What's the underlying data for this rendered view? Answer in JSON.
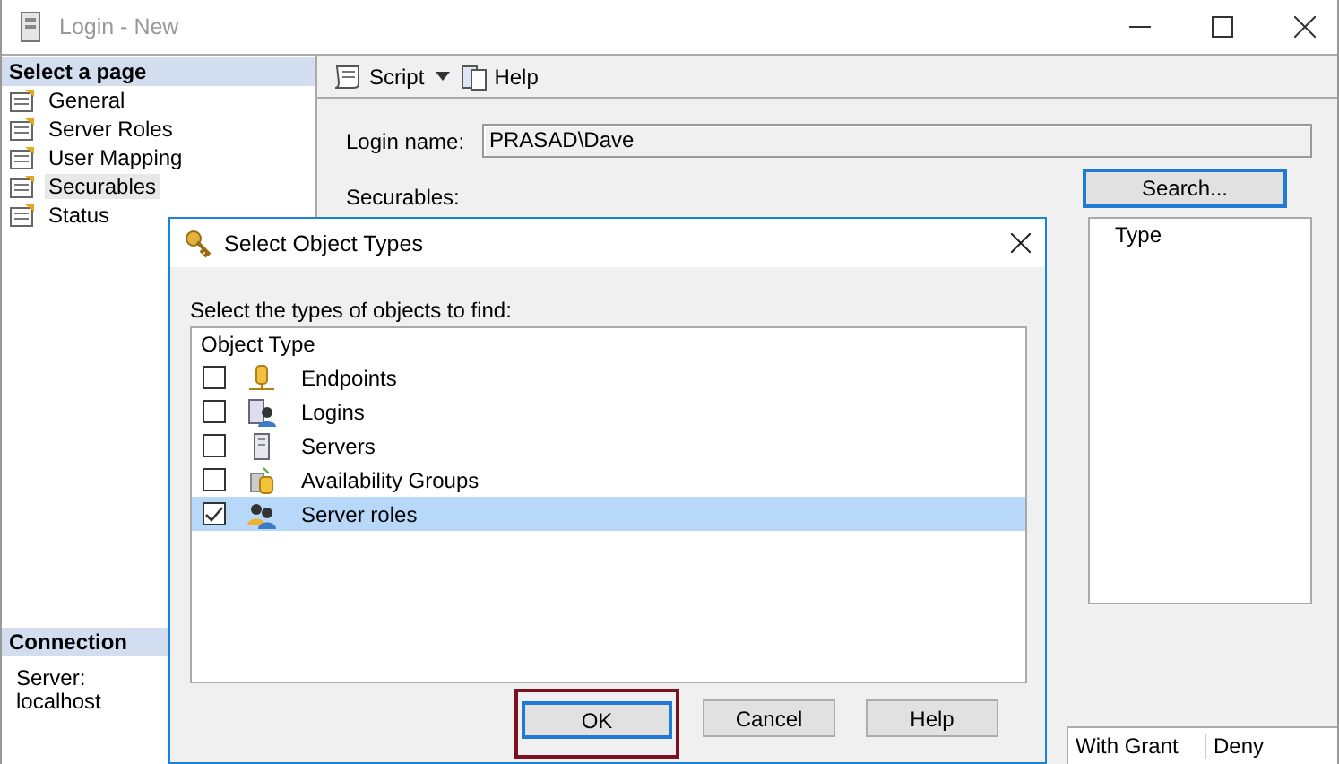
{
  "window": {
    "title": "Login - New"
  },
  "sidebar": {
    "header": "Select a page",
    "items": [
      {
        "label": "General",
        "selected": false
      },
      {
        "label": "Server Roles",
        "selected": false
      },
      {
        "label": "User Mapping",
        "selected": false
      },
      {
        "label": "Securables",
        "selected": true
      },
      {
        "label": "Status",
        "selected": false
      }
    ],
    "connection": {
      "header": "Connection",
      "label": "Server:",
      "value": "localhost"
    }
  },
  "toolbar": {
    "script": "Script",
    "help": "Help"
  },
  "form": {
    "login_label": "Login name:",
    "login_value": "PRASAD\\Dave",
    "securables_label": "Securables:",
    "search_button": "Search...",
    "grid_column": "Type",
    "permissions_columns": [
      "With Grant",
      "Deny"
    ]
  },
  "dialog": {
    "title": "Select Object Types",
    "prompt": "Select the types of objects to find:",
    "column": "Object Type",
    "items": [
      {
        "label": "Endpoints",
        "checked": false,
        "selected": false,
        "kind": "endpoint"
      },
      {
        "label": "Logins",
        "checked": false,
        "selected": false,
        "kind": "login"
      },
      {
        "label": "Servers",
        "checked": false,
        "selected": false,
        "kind": "server"
      },
      {
        "label": "Availability Groups",
        "checked": false,
        "selected": false,
        "kind": "group"
      },
      {
        "label": "Server roles",
        "checked": true,
        "selected": true,
        "kind": "role"
      }
    ],
    "buttons": [
      {
        "label": "OK",
        "highlighted": true
      },
      {
        "label": "Cancel",
        "highlighted": false
      },
      {
        "label": "Help",
        "highlighted": false
      }
    ]
  }
}
